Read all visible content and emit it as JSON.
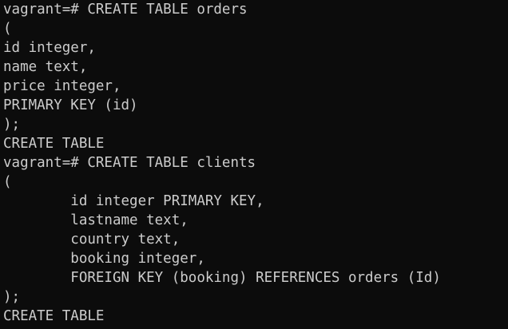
{
  "terminal": {
    "lines": [
      "vagrant=# CREATE TABLE orders",
      "(",
      "id integer,",
      "name text,",
      "price integer,",
      "PRIMARY KEY (id)",
      ");",
      "CREATE TABLE",
      "vagrant=# CREATE TABLE clients",
      "(",
      "        id integer PRIMARY KEY,",
      "        lastname text,",
      "        country text,",
      "        booking integer,",
      "        FOREIGN KEY (booking) REFERENCES orders (Id)",
      ");",
      "CREATE TABLE"
    ]
  },
  "colors": {
    "background": "#0c0c0c",
    "foreground": "#cccccc"
  }
}
